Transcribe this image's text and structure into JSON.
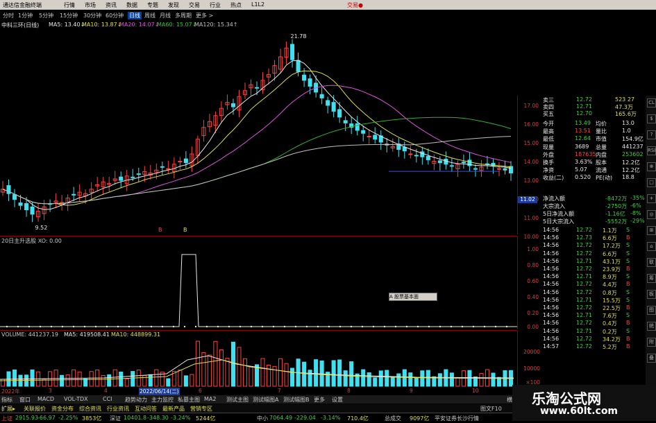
{
  "app": {
    "title": "通达信金融终端",
    "menu": [
      "行情",
      "市场",
      "资讯",
      "数据",
      "专题",
      "发现",
      "交易",
      "行业",
      "热点",
      "L1L2"
    ],
    "right_label": "交易●"
  },
  "periods": [
    "分时",
    "1分钟",
    "5分钟",
    "15分钟",
    "30分钟",
    "60分钟",
    "日线",
    "周线",
    "月线",
    "多周期",
    "更多 >"
  ],
  "main": {
    "stock_name": "中科三环(日线)",
    "ma5": "MA5: 13.40↓",
    "ma10": "MA10: 13.87↓",
    "ma20": "MA20: 14.07↓",
    "ma60": "MA60: 15.07↓",
    "ma120": "MA120: 15.34↑",
    "high_label": "21.78",
    "low_label": "9.52",
    "price_axis": [
      "17.00",
      "16.00",
      "15.00",
      "14.00",
      "13.00",
      "12.00",
      "11.00",
      "10.00"
    ],
    "current_price_label": "11.02",
    "markers": [
      "B",
      "B"
    ]
  },
  "indicator": {
    "header": "20日主升选股 XO: 0.00",
    "axis": [
      "1.00",
      "0.80",
      "0.60",
      "0.40",
      "0.20",
      "0.00"
    ],
    "popup_label": "A 股票基本面"
  },
  "volume": {
    "header_vol": "VOLUME: 441237.19",
    "header_ma5": "MA5: 419508.41",
    "header_ma10": "MA10: 448899.31",
    "axis": [
      "20000",
      "10000"
    ],
    "axis_unit": "×100",
    "date_label": "2022/06/14(二)",
    "x_labels": [
      "2022年",
      "3",
      "4",
      "5",
      "6",
      "7",
      "8",
      "9",
      "10"
    ]
  },
  "quote_panel": {
    "rows": [
      {
        "label": "卖三",
        "value": "12.72",
        "vol": "523 27"
      },
      {
        "label": "卖四",
        "value": "12.71",
        "vol": "47.3万"
      },
      {
        "label": "买五",
        "value": "12.70",
        "vol": "165.6万"
      },
      {
        "label": "今开",
        "value": "13.49",
        "label2": "均价",
        "value2": "13.0"
      },
      {
        "label": "最高",
        "value": "13.51",
        "label2": "量比",
        "value2": "1.0"
      },
      {
        "label": "最低",
        "value": "12.64",
        "label2": "市值",
        "value2": "154.9亿"
      },
      {
        "label": "现量",
        "value": "3689",
        "label2": "总量",
        "value2": "441237"
      },
      {
        "label": "外盘",
        "value": "187635",
        "label2": "内盘",
        "value2": "253602"
      },
      {
        "label": "换手",
        "value": "3.63%",
        "label2": "股本",
        "value2": "12.2亿"
      },
      {
        "label": "净资",
        "value": "5.07",
        "label2": "流通",
        "value2": "12.2亿"
      },
      {
        "label": "收益(二)",
        "value": "0.520",
        "label2": "PE(动)",
        "value2": "18.8"
      }
    ],
    "flows": [
      {
        "label": "净流入额",
        "value": "-8472万",
        "pct": "-35%"
      },
      {
        "label": "大宗流入",
        "value": "-2750万",
        "pct": "-6%"
      },
      {
        "label": "5日净流入额",
        "value": "-1.16亿",
        "pct": "-8%"
      },
      {
        "label": "5日大宗流入",
        "value": "-5552万",
        "pct": "-29%"
      }
    ],
    "trades": [
      {
        "t": "14:56",
        "p": "12.72",
        "v": "1.1万",
        "s": "S"
      },
      {
        "t": "14:56",
        "p": "12.73",
        "v": "6.6万",
        "s": "B"
      },
      {
        "t": "14:56",
        "p": "12.72",
        "v": "17.2万",
        "s": "S"
      },
      {
        "t": "14:56",
        "p": "12.72",
        "v": "6.6万",
        "s": "S"
      },
      {
        "t": "14:56",
        "p": "12.71",
        "v": "43.1万",
        "s": "S"
      },
      {
        "t": "14:56",
        "p": "12.72",
        "v": "23.9万",
        "s": "B"
      },
      {
        "t": "14:56",
        "p": "12.71",
        "v": "8.9万",
        "s": "S"
      },
      {
        "t": "14:56",
        "p": "12.72",
        "v": "4.4万",
        "s": "B"
      },
      {
        "t": "14:56",
        "p": "12.72",
        "v": "0.8万",
        "s": "S"
      },
      {
        "t": "14:56",
        "p": "12.71",
        "v": "15.5万",
        "s": "S"
      },
      {
        "t": "14:56",
        "p": "12.72",
        "v": "22.5万",
        "s": "B"
      },
      {
        "t": "14:56",
        "p": "12.71",
        "v": "7.6万",
        "s": "S"
      },
      {
        "t": "14:56",
        "p": "12.72",
        "v": "0.4万",
        "s": "B"
      },
      {
        "t": "14:56",
        "p": "12.71",
        "v": "0.2万",
        "s": "S"
      },
      {
        "t": "14:56",
        "p": "12.72",
        "v": "34.2万",
        "s": "B"
      },
      {
        "t": "14:57",
        "p": "12.72",
        "v": "5.2万",
        "s": "B"
      }
    ]
  },
  "bottom_tabs": [
    "指标",
    "窗口",
    "MACD",
    "VOL-TDX",
    "CCI",
    "趋势动力",
    "主力监控",
    "私募主图",
    "MA2",
    "测试主图",
    "测试幅图A",
    "测试幅图B",
    "更多",
    "设置"
  ],
  "bottom_tabs2": [
    "扩展▸",
    "关联报价",
    "资金分布",
    "综合资讯",
    "行业资讯",
    "互动问答",
    "最新产品",
    "营销专区"
  ],
  "bottom_right": "横栏",
  "bottom_right2": "图文F10",
  "status": {
    "sh_label": "上证",
    "sh": "2915.93",
    "sh_chg": "-66.97",
    "sh_pct": "-2.25%",
    "sh_amt": "3853亿",
    "sz_label": "深证",
    "sz": "10401.8",
    "sz_chg": "-348.30",
    "sz_pct": "-3.24%",
    "sz_amt": "5244亿",
    "zx_label": "中小",
    "zx": "7064.49",
    "zx_chg": "-229.04",
    "zx_pct": "-3.14%",
    "zx_amt": "710.4亿",
    "total_label": "总成交",
    "total": "9097亿",
    "broker": "平安证券长沙行情"
  },
  "watermark": {
    "line1": "乐淘公式网",
    "line2": "www.60lt.com"
  },
  "side_tools": [
    "CL",
    "$",
    "?",
    "RSI",
    "⊕",
    "□",
    "+",
    "◎",
    "⊞",
    "⌂",
    "联",
    "筹",
    "板",
    "图",
    "统",
    "附",
    "叠"
  ],
  "colors": {
    "up": "#ff4040",
    "down": "#40e0f0",
    "ma5": "#e8e8e8",
    "ma10": "#e0e040",
    "ma20": "#e050e0",
    "ma60": "#30b030",
    "ma120": "#c0c0c0",
    "frame": "#8b0000"
  },
  "chart_data": {
    "type": "candlestick",
    "title": "中科三环(日线)",
    "ylim": [
      9,
      18.2
    ],
    "close": [
      11.6,
      11.3,
      10.9,
      10.5,
      10.2,
      9.9,
      10.1,
      10.4,
      10.6,
      10.8,
      10.7,
      11.0,
      11.2,
      11.4,
      11.3,
      11.6,
      11.9,
      12.1,
      12.0,
      12.3,
      12.2,
      12.5,
      12.4,
      12.6,
      12.8,
      12.7,
      12.9,
      13.1,
      13.0,
      13.3,
      13.5,
      13.4,
      14.0,
      15.0,
      15.8,
      16.2,
      16.6,
      17.1,
      17.5,
      17.2,
      17.9,
      18.3,
      18.7,
      18.5,
      19.0,
      19.4,
      20.0,
      20.6,
      21.2,
      20.4,
      19.6,
      19.0,
      18.6,
      18.2,
      17.8,
      17.3,
      16.9,
      16.5,
      16.1,
      15.8,
      15.6,
      15.4,
      15.2,
      15.0,
      14.8,
      14.6,
      14.5,
      14.3,
      14.2,
      14.0,
      13.9,
      13.8,
      13.6,
      13.5,
      13.4,
      13.3,
      13.2,
      13.3,
      13.4,
      13.2,
      13.0,
      13.1,
      13.3,
      13.2,
      13.0,
      12.9,
      12.7
    ]
  }
}
